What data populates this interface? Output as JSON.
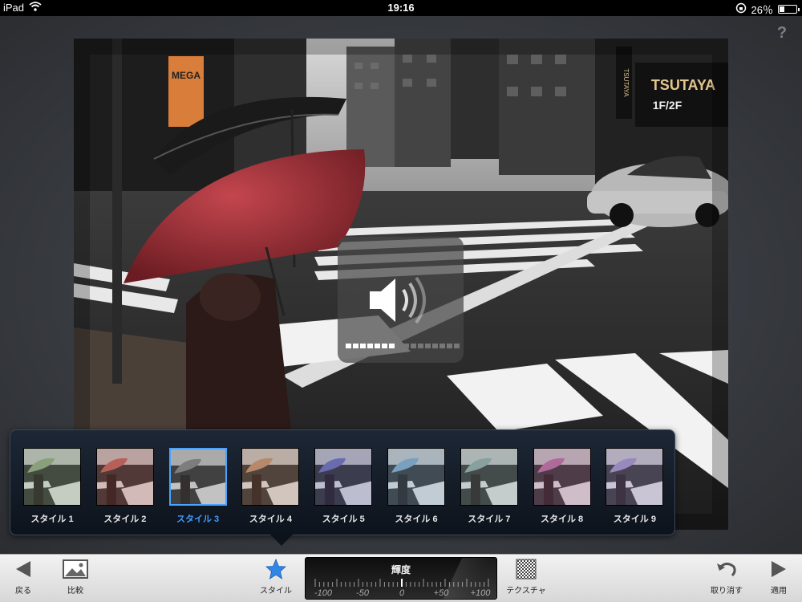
{
  "status_bar": {
    "device": "iPad",
    "time": "19:16",
    "battery": "26％",
    "battery_level": 0.26
  },
  "help": {
    "label": "?"
  },
  "photo": {
    "signs": {
      "mega": "MEGA",
      "tsutaya": "TSUTAYA",
      "tsutaya_floor": "1F/2F",
      "tsutaya_vertical": "TSUTAYA"
    }
  },
  "volume_hud": {
    "icon": "speaker-icon",
    "level": 0.45
  },
  "styles": {
    "selected_index": 2,
    "items": [
      {
        "label": "スタイル 1",
        "tint": "#8aa07a"
      },
      {
        "label": "スタイル 2",
        "tint": "#b8605a"
      },
      {
        "label": "スタイル 3",
        "tint": "#7d7d7d"
      },
      {
        "label": "スタイル 4",
        "tint": "#b88a6a"
      },
      {
        "label": "スタイル 5",
        "tint": "#6a6ab0"
      },
      {
        "label": "スタイル 6",
        "tint": "#7aa0c0"
      },
      {
        "label": "スタイル 7",
        "tint": "#8aa0a0"
      },
      {
        "label": "スタイル 8",
        "tint": "#b06a9a"
      },
      {
        "label": "スタイル 9",
        "tint": "#9a8ac0"
      }
    ]
  },
  "toolbar": {
    "back": "戻る",
    "compare": "比較",
    "style": "スタイル",
    "texture": "テクスチャ",
    "undo": "取り消す",
    "apply": "適用"
  },
  "slider": {
    "title": "輝度",
    "scale": [
      "-100",
      "-50",
      "0",
      "+50",
      "+100"
    ],
    "value": 0
  },
  "colors": {
    "accent": "#3f9bff",
    "toolbar_bg": "#e0e0e0",
    "strip_bg": "#141c28"
  }
}
